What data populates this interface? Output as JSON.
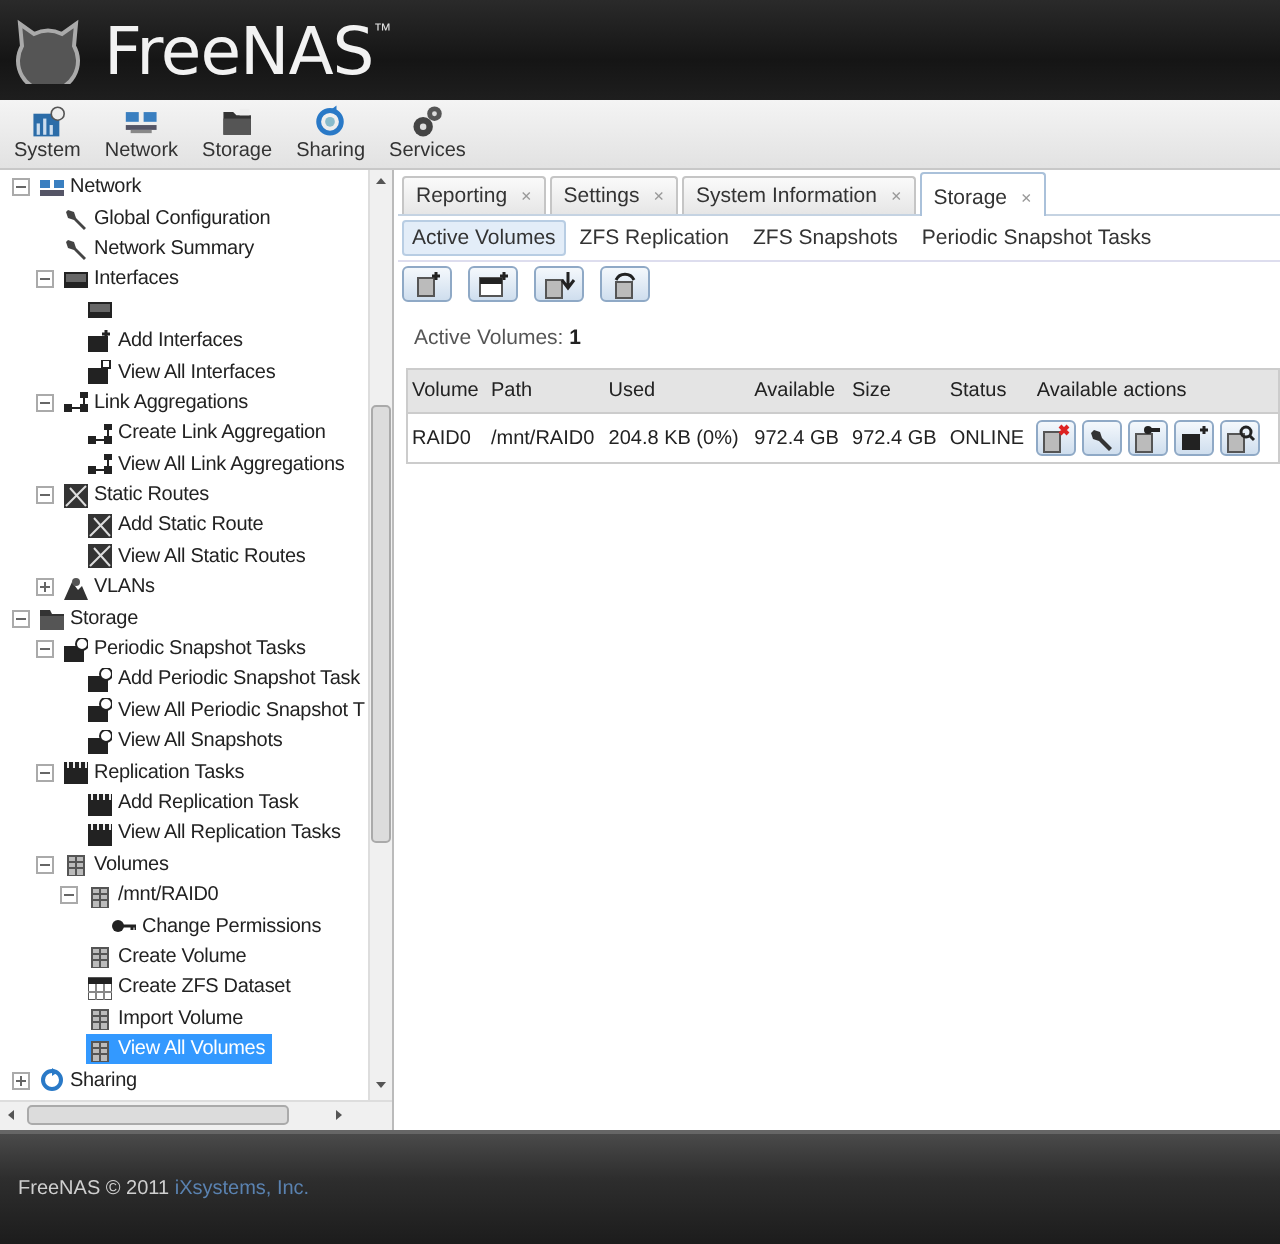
{
  "header": {
    "logo_text": "FreeNAS",
    "trademark": "™"
  },
  "toolbar": [
    {
      "label": "System"
    },
    {
      "label": "Network"
    },
    {
      "label": "Storage"
    },
    {
      "label": "Sharing"
    },
    {
      "label": "Services"
    }
  ],
  "tree": [
    {
      "label": "Network",
      "expanded": true,
      "selected": false,
      "children": [
        {
          "label": "Global Configuration",
          "selected": false
        },
        {
          "label": "Network Summary",
          "selected": false
        },
        {
          "label": "Interfaces",
          "expanded": true,
          "selected": false,
          "children": [
            {
              "selected": false
            },
            {
              "label": "Add Interfaces",
              "selected": false
            },
            {
              "label": "View All Interfaces",
              "selected": false
            }
          ]
        },
        {
          "label": "Link Aggregations",
          "expanded": true,
          "selected": false,
          "children": [
            {
              "label": "Create Link Aggregation",
              "selected": false
            },
            {
              "label": "View All Link Aggregations",
              "selected": false
            }
          ]
        },
        {
          "label": "Static Routes",
          "expanded": true,
          "selected": false,
          "children": [
            {
              "label": "Add Static Route",
              "selected": false
            },
            {
              "label": "View All Static Routes",
              "selected": false
            }
          ]
        },
        {
          "label": "VLANs",
          "expanded": false,
          "selected": false
        }
      ]
    },
    {
      "label": "Storage",
      "expanded": true,
      "selected": false,
      "children": [
        {
          "label": "Periodic Snapshot Tasks",
          "expanded": true,
          "selected": false,
          "children": [
            {
              "label": "Add Periodic Snapshot Task",
              "selected": false
            },
            {
              "label": "View All Periodic Snapshot T",
              "selected": false
            },
            {
              "label": "View All Snapshots",
              "selected": false
            }
          ]
        },
        {
          "label": "Replication Tasks",
          "expanded": true,
          "selected": false,
          "children": [
            {
              "label": "Add Replication Task",
              "selected": false
            },
            {
              "label": "View All Replication Tasks",
              "selected": false
            }
          ]
        },
        {
          "label": "Volumes",
          "expanded": true,
          "selected": false,
          "children": [
            {
              "label": "/mnt/RAID0",
              "expanded": true,
              "selected": false,
              "children": [
                {
                  "label": "Change Permissions",
                  "selected": false
                }
              ]
            },
            {
              "label": "Create Volume",
              "selected": false
            },
            {
              "label": "Create ZFS Dataset",
              "selected": false
            },
            {
              "label": "Import Volume",
              "selected": false
            },
            {
              "label": "View All Volumes",
              "selected": true
            }
          ]
        }
      ]
    },
    {
      "label": "Sharing",
      "expanded": false,
      "selected": false
    }
  ],
  "tabs": [
    {
      "label": "Reporting",
      "close": "×",
      "selected": false
    },
    {
      "label": "Settings",
      "close": "×",
      "selected": false
    },
    {
      "label": "System Information",
      "close": "×",
      "selected": false
    },
    {
      "label": "Storage",
      "close": "×",
      "selected": true
    }
  ],
  "subtabs": [
    {
      "label": "Active Volumes",
      "selected": true
    },
    {
      "label": "ZFS Replication",
      "selected": false
    },
    {
      "label": "ZFS Snapshots",
      "selected": false
    },
    {
      "label": "Periodic Snapshot Tasks",
      "selected": false
    }
  ],
  "summary": "Active Volumes: **1**",
  "table": {
    "columns": [
      "Volume",
      "Path",
      "Used",
      "Available",
      "Size",
      "Status",
      "Available actions"
    ],
    "rows": [
      {
        "cells": [
          "RAID0",
          "/mnt/RAID0",
          "204.8 KB (0%)",
          "972.4 GB",
          "972.4 GB",
          "ONLINE"
        ]
      }
    ]
  },
  "footer": {
    "text": "FreeNAS © 2011 ",
    "link": "iXsystems, Inc."
  }
}
